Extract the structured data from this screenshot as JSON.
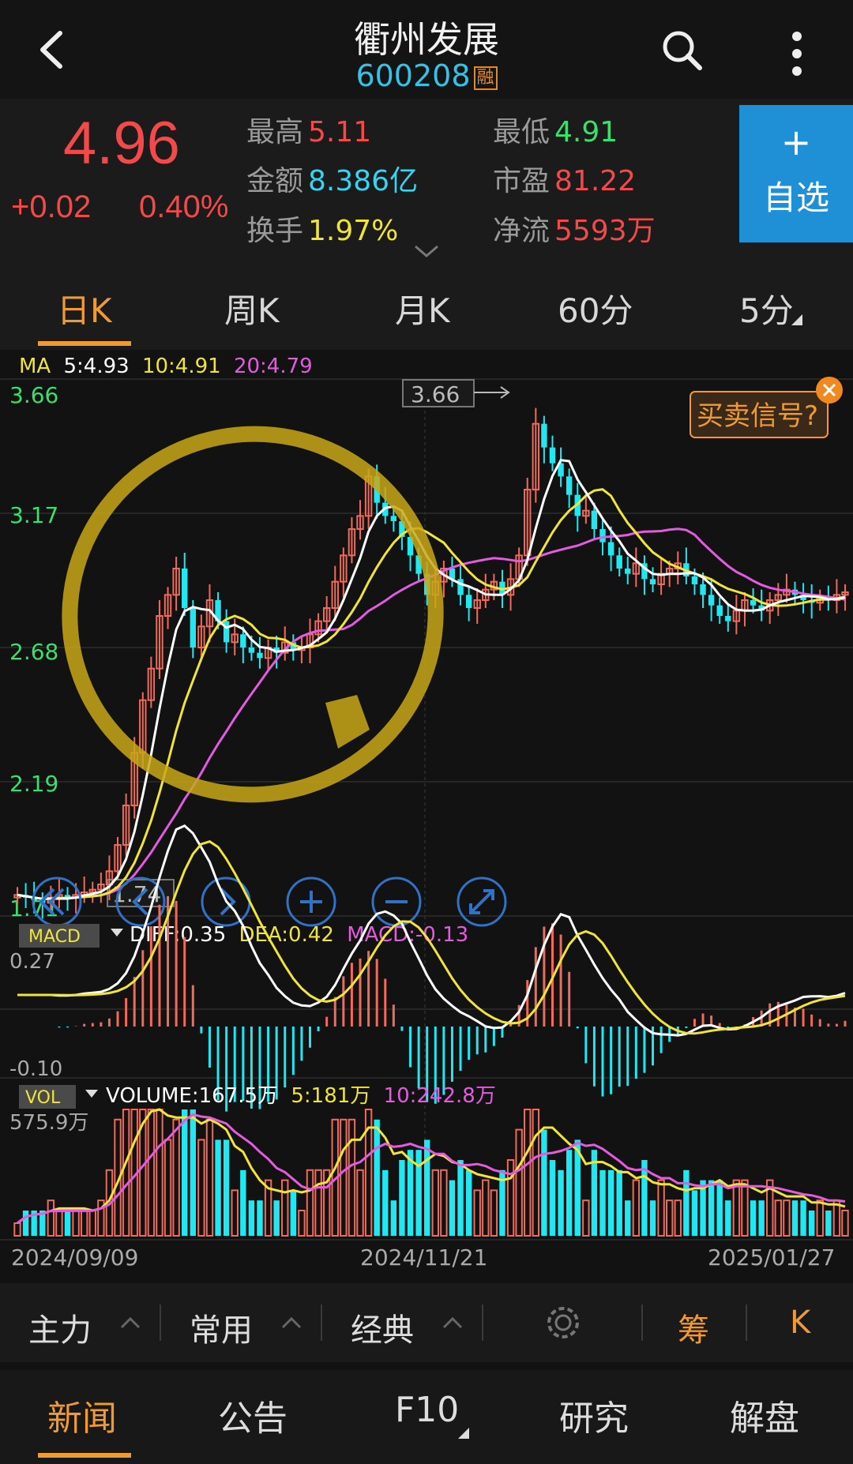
{
  "header": {
    "title": "衢州发展",
    "code": "600208",
    "badge": "融"
  },
  "quote": {
    "price": "4.96",
    "change": "+0.02",
    "change_pct": "0.40%",
    "stats": [
      {
        "label": "最高",
        "value": "5.11"
      },
      {
        "label": "金额",
        "value": "8.386亿"
      },
      {
        "label": "换手",
        "value": "1.97%"
      },
      {
        "label": "最低",
        "value": "4.91"
      },
      {
        "label": "市盈",
        "value": "81.22"
      },
      {
        "label": "净流",
        "value": "5593万"
      }
    ],
    "add_button": {
      "plus": "+",
      "label": "自选"
    }
  },
  "period_tabs": [
    "日K",
    "周K",
    "月K",
    "60分",
    "5分"
  ],
  "chart": {
    "ma_legend": {
      "prefix": "MA",
      "ma5": "5:4.93",
      "ma10": "10:4.91",
      "ma20": "20:4.79"
    },
    "price_axis": [
      "3.66",
      "3.17",
      "2.68",
      "2.19",
      "1.71"
    ],
    "high_marker": "3.66",
    "low_marker": "1.74",
    "signal_button": "买卖信号?",
    "macd": {
      "tag": "MACD",
      "diff": "DIFF:0.35",
      "dea": "DEA:0.42",
      "macd": "MACD:-0.13",
      "axis_top": "0.27",
      "axis_bottom": "-0.10"
    },
    "vol": {
      "tag": "VOL",
      "volume": "VOLUME:167.5万",
      "ma5": "5:181万",
      "ma10": "10:242.8万",
      "axis_top": "575.9万"
    },
    "dates": [
      "2024/09/09",
      "2024/11/21",
      "2025/01/27"
    ],
    "colors": {
      "up": "#f26a5a",
      "down": "#22e6f0",
      "ma5": "#ffffff",
      "ma10": "#f0e43a",
      "ma20": "#e45ae0",
      "annotation": "#c9a818"
    }
  },
  "chart_data": {
    "type": "candlestick",
    "y_range": [
      1.71,
      3.66
    ],
    "closes": [
      1.76,
      1.75,
      1.74,
      1.73,
      1.75,
      1.76,
      1.75,
      1.76,
      1.77,
      1.78,
      1.8,
      1.85,
      1.95,
      2.1,
      2.3,
      2.5,
      2.62,
      2.82,
      2.9,
      3.0,
      2.85,
      2.7,
      2.78,
      2.88,
      2.8,
      2.72,
      2.75,
      2.7,
      2.68,
      2.66,
      2.7,
      2.68,
      2.72,
      2.69,
      2.7,
      2.75,
      2.8,
      2.85,
      2.95,
      3.05,
      3.15,
      3.2,
      3.35,
      3.25,
      3.2,
      3.18,
      3.12,
      3.05,
      2.98,
      2.9,
      2.95,
      3.0,
      2.96,
      2.9,
      2.85,
      2.88,
      2.92,
      2.95,
      2.9,
      2.96,
      3.05,
      3.3,
      3.55,
      3.46,
      3.4,
      3.35,
      3.28,
      3.2,
      3.22,
      3.15,
      3.1,
      3.05,
      3.0,
      2.98,
      3.02,
      2.96,
      2.94,
      2.98,
      3.0,
      3.02,
      2.97,
      2.94,
      2.9,
      2.86,
      2.82,
      2.8,
      2.84,
      2.88,
      2.86,
      2.84,
      2.88,
      2.9,
      2.92,
      2.9,
      2.88,
      2.87,
      2.89,
      2.88,
      2.9,
      2.91
    ]
  },
  "bottom_tools": [
    "主力",
    "常用",
    "经典",
    "筹",
    "K"
  ],
  "bottom_nav": [
    "新闻",
    "公告",
    "F10",
    "研究",
    "解盘"
  ]
}
